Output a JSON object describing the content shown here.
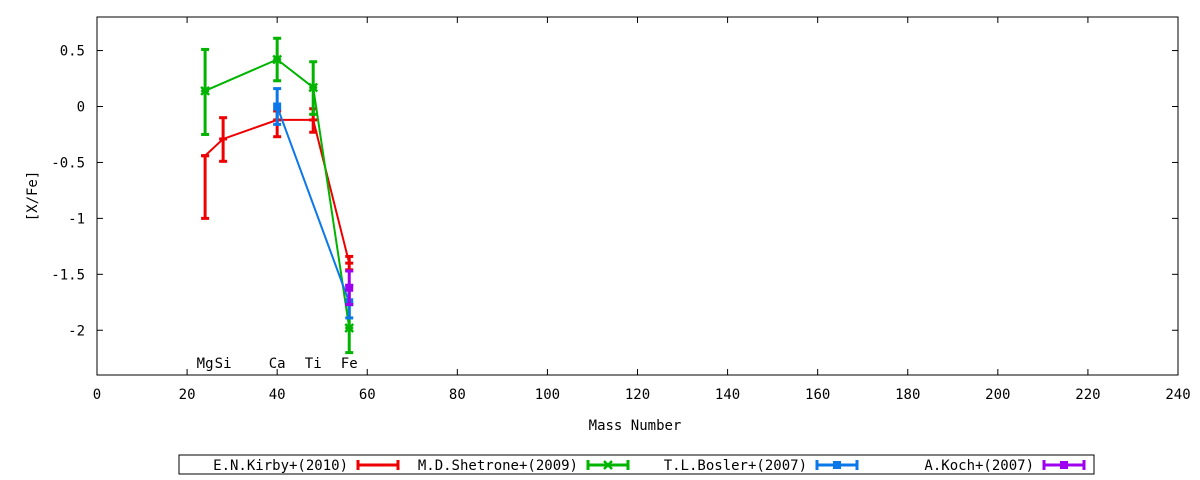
{
  "chart_data": {
    "type": "line",
    "xlabel": "Mass Number",
    "ylabel": "[X/Fe]",
    "xlim": [
      0,
      240
    ],
    "ylim": [
      -2.4,
      0.8
    ],
    "xticks": [
      "0",
      "20",
      "40",
      "60",
      "80",
      "100",
      "120",
      "140",
      "160",
      "180",
      "200",
      "220",
      "240"
    ],
    "xtick_values": [
      0,
      20,
      40,
      60,
      80,
      100,
      120,
      140,
      160,
      180,
      200,
      220,
      240
    ],
    "yticks": [
      "0.5",
      "0",
      "-0.5",
      "-1",
      "-1.5",
      "-2"
    ],
    "ytick_values": [
      0.5,
      0,
      -0.5,
      -1,
      -1.5,
      -2
    ],
    "element_labels": [
      {
        "text": "Mg",
        "x": 24
      },
      {
        "text": "Si",
        "x": 28
      },
      {
        "text": "Ca",
        "x": 40
      },
      {
        "text": "Ti",
        "x": 48
      },
      {
        "text": "Fe",
        "x": 56
      }
    ],
    "legend_placement": "bottom-center",
    "grid": false,
    "series": [
      {
        "name": "E.N.Kirby+(2010)",
        "color": "#ee0000",
        "marker": "bar",
        "points": [
          {
            "x": 24,
            "y": -0.44,
            "ylo": -1.0,
            "yhi": -0.44
          },
          {
            "x": 28,
            "y": -0.29,
            "ylo": -0.49,
            "yhi": -0.1
          },
          {
            "x": 40,
            "y": -0.12,
            "ylo": -0.27,
            "yhi": -0.04
          },
          {
            "x": 48,
            "y": -0.12,
            "ylo": -0.23,
            "yhi": -0.02
          },
          {
            "x": 56,
            "y": -1.4,
            "ylo": -1.46,
            "yhi": -1.34
          }
        ]
      },
      {
        "name": "M.D.Shetrone+(2009)",
        "color": "#00b400",
        "marker": "cross",
        "points": [
          {
            "x": 24,
            "y": 0.14,
            "ylo": -0.25,
            "yhi": 0.51
          },
          {
            "x": 40,
            "y": 0.42,
            "ylo": 0.23,
            "yhi": 0.61
          },
          {
            "x": 48,
            "y": 0.17,
            "ylo": -0.07,
            "yhi": 0.4
          },
          {
            "x": 56,
            "y": -1.98,
            "ylo": -2.2,
            "yhi": -1.76
          }
        ]
      },
      {
        "name": "T.L.Bosler+(2007)",
        "color": "#0a78e8",
        "marker": "square",
        "points": [
          {
            "x": 40,
            "y": 0.0,
            "ylo": -0.16,
            "yhi": 0.16
          },
          {
            "x": 56,
            "y": -1.75,
            "ylo": -1.89,
            "yhi": -1.6
          }
        ]
      },
      {
        "name": "A.Koch+(2007)",
        "color": "#a000f0",
        "marker": "square",
        "points": [
          {
            "x": 56,
            "y": -1.62,
            "ylo": -1.77,
            "yhi": -1.47
          }
        ]
      }
    ]
  }
}
